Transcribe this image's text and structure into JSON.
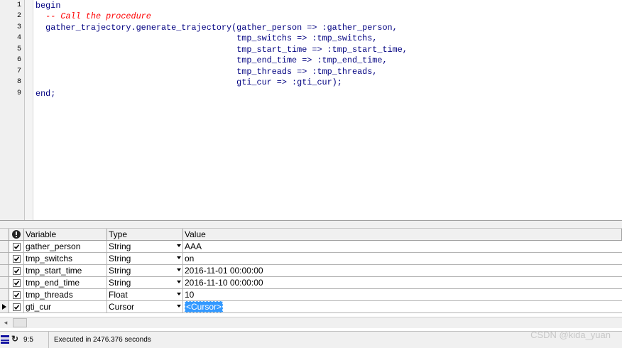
{
  "editor": {
    "line_numbers": [
      "1",
      "2",
      "3",
      "4",
      "5",
      "6",
      "7",
      "8",
      "9"
    ],
    "lines": [
      "begin",
      "  -- Call the procedure",
      "  gather_trajectory.generate_trajectory(gather_person => :gather_person,",
      "                                        tmp_switchs => :tmp_switchs,",
      "                                        tmp_start_time => :tmp_start_time,",
      "                                        tmp_end_time => :tmp_end_time,",
      "                                        tmp_threads => :tmp_threads,",
      "                                        gti_cur => :gti_cur);",
      "end;"
    ],
    "code_color": "#000080",
    "comment_color": "#ff0000"
  },
  "grid": {
    "headers": {
      "variable": "Variable",
      "type": "Type",
      "value": "Value"
    },
    "rows": [
      {
        "checked": true,
        "variable": "gather_person",
        "type": "String",
        "value": "AAA"
      },
      {
        "checked": true,
        "variable": "tmp_switchs",
        "type": "String",
        "value": "on"
      },
      {
        "checked": true,
        "variable": "tmp_start_time",
        "type": "String",
        "value": "2016-11-01 00:00:00"
      },
      {
        "checked": true,
        "variable": "tmp_end_time",
        "type": "String",
        "value": "2016-11-10 00:00:00"
      },
      {
        "checked": true,
        "variable": "tmp_threads",
        "type": "Float",
        "value": "10"
      },
      {
        "checked": true,
        "variable": "gti_cur",
        "type": "Cursor",
        "value": "<Cursor>"
      }
    ],
    "selected_color": "#3399ff"
  },
  "statusbar": {
    "position": "9:5",
    "message": "Executed in 2476.376 seconds"
  },
  "watermark": "CSDN @kida_yuan"
}
